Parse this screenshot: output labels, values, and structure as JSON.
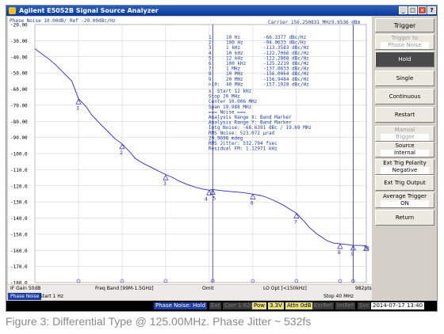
{
  "window": {
    "title": "Agilent E5052B Signal Source Analyzer",
    "controls": [
      "_",
      "□",
      "×",
      "?"
    ]
  },
  "trace_header": {
    "left": "Phase Noise 10.00dB/ Ref -20.00dBc/Hz",
    "center": "Carrier 156.250831 MHz",
    "right": "9.6536 dBm"
  },
  "marker_table": [
    {
      "n": "1:",
      "freq": "10 Hz",
      "val": "-66.3377 dBc/Hz"
    },
    {
      "n": "2:",
      "freq": "100 Hz",
      "val": "-94.0633 dBc/Hz"
    },
    {
      "n": "3:",
      "freq": "1 kHz",
      "val": "-113.3583 dBc/Hz"
    },
    {
      "n": "4:",
      "freq": "10 kHz",
      "val": "-122.7066 dBc/Hz"
    },
    {
      "n": "5:",
      "freq": "12 kHz",
      "val": "-122.2868 dBc/Hz"
    },
    {
      "n": "6:",
      "freq": "100 kHz",
      "val": "-125.2219 dBc/Hz"
    },
    {
      "n": "7:",
      "freq": "1 MHz",
      "val": "-137.0633 dBc/Hz"
    },
    {
      "n": "8:",
      "freq": "10 MHz",
      "val": "-156.0064 dBc/Hz"
    },
    {
      "n": "9:",
      "freq": "20 MHz",
      "val": "-156.9484 dBc/Hz"
    },
    {
      "n": ">10:",
      "freq": "40 MHz",
      "val": "-157.1928 dBc/Hz"
    }
  ],
  "analysis_lines": [
    "x: Start 12 kHz",
    "    Stop 20 MHz",
    "  Center 10.006 MHz",
    "    Span 19.988 MHz",
    "=== Noise ===",
    "Analysis Range X: Band Marker",
    "Analysis Range Y: Band Marker",
    "Intg Noise: -68.6391 dBc / 19.69 MHz",
    "  RMS Noise: 523.072 µrad",
    "             29.9698 mdeg",
    "RMS Jitter: 532.794 fsec",
    "Residual FM: 1.12971 kHz"
  ],
  "y_ticks": [
    "-20.00",
    "-30.00",
    "-40.00",
    "-50.00",
    "-60.00",
    "-70.00",
    "-80.00",
    "-90.00",
    "-100.0",
    "-110.0",
    "-120.0",
    "-130.0",
    "-140.0",
    "-150.0",
    "-160.0",
    "-170.0",
    "-180.0"
  ],
  "chart_data": {
    "type": "line",
    "ylabel": "Phase Noise (dBc/Hz)",
    "ylim": [
      -180,
      -20
    ],
    "xlim_hz": [
      1,
      40000000
    ],
    "x_scale": "log",
    "grid": true,
    "series": [
      {
        "x": [
          1,
          2,
          3,
          5,
          7,
          10,
          15,
          20,
          30,
          50,
          70,
          100,
          150,
          200,
          300,
          500,
          700,
          1000,
          1500,
          2000,
          3000,
          5000,
          7000,
          10000,
          12000,
          20000,
          30000,
          50000,
          70000,
          100000,
          150000,
          200000,
          300000,
          500000,
          700000,
          1000000,
          1500000,
          2000000,
          3000000,
          5000000,
          7000000,
          10000000,
          15000000,
          20000000,
          30000000,
          40000000
        ],
        "values": [
          -35,
          -41,
          -45,
          -51,
          -55,
          -66,
          -71,
          -76,
          -81,
          -87,
          -91,
          -94,
          -99,
          -103,
          -106,
          -109,
          -111,
          -113,
          -115,
          -117,
          -119,
          -121,
          -122,
          -122.7,
          -122.3,
          -123,
          -123.5,
          -124,
          -124.5,
          -125.2,
          -126,
          -127,
          -129,
          -132,
          -134.5,
          -137,
          -142,
          -146,
          -150,
          -154,
          -155.5,
          -156,
          -156.5,
          -157,
          -157,
          -157.2
        ]
      }
    ],
    "markers": [
      {
        "label": "1",
        "x": 10,
        "y": -66.3377
      },
      {
        "label": "2",
        "x": 100,
        "y": -94.0633
      },
      {
        "label": "3",
        "x": 1000,
        "y": -113.3583
      },
      {
        "label": "4",
        "x": 10000,
        "y": -122.7066
      },
      {
        "label": "5",
        "x": 12000,
        "y": -122.2868
      },
      {
        "label": "6",
        "x": 100000,
        "y": -125.2219
      },
      {
        "label": "7",
        "x": 1000000,
        "y": -137.0633
      },
      {
        "label": "8",
        "x": 10000000,
        "y": -156.0064
      },
      {
        "label": "9",
        "x": 20000000,
        "y": -156.9484
      },
      {
        "label": "10",
        "x": 40000000,
        "y": -157.1928
      }
    ],
    "band_start_hz": 12000,
    "band_stop_hz": 20000000
  },
  "status_row1": {
    "if_gain": "IF Gain 50dB",
    "freq_band": "Freq Band [99M-1.5GHz]",
    "omit": "Omit",
    "lo_opt": "LO Opt [<150kHz]",
    "points": "982pts"
  },
  "status_row2": {
    "mode": "Phase Noise",
    "start": "Start 1 Hz",
    "stop": "Stop 40 MHz"
  },
  "bottom_bar": {
    "meas": "Phase Noise: Hold",
    "ext": "Ext",
    "corr": "Corr 1.620",
    "pow": "Pow",
    "pow_val": "3.3V",
    "attn": "Attn 0dB",
    "extref": "ExtRef",
    "intref": "IntRef",
    "svc": "Svc",
    "datetime": "2014-07-17 13:40"
  },
  "panel": {
    "title": "Trigger",
    "buttons": [
      {
        "label": "Trigger to",
        "sub": "Phase Noise",
        "dim": true
      },
      {
        "label": "Hold",
        "dark": true
      },
      {
        "label": "Single"
      },
      {
        "label": "Continuous"
      },
      {
        "label": "Restart"
      },
      {
        "label": "Manual",
        "sub": "Trigger",
        "dim": true
      },
      {
        "label": "Source",
        "sub": "Internal"
      },
      {
        "label": "Ext Trig Polarity",
        "sub": "Negative"
      },
      {
        "label": "Ext Trig Output"
      },
      {
        "label": "Average Trigger",
        "sub": "ON"
      },
      {
        "label": "Return"
      }
    ]
  },
  "caption": "Figure 3: Differential Type @ 125.00MHz. Phase Jitter ~ 532fs",
  "colors": {
    "trace": "#2b2bb8",
    "grid": "#c8c8c8",
    "titlebar": "#0c3a96"
  }
}
